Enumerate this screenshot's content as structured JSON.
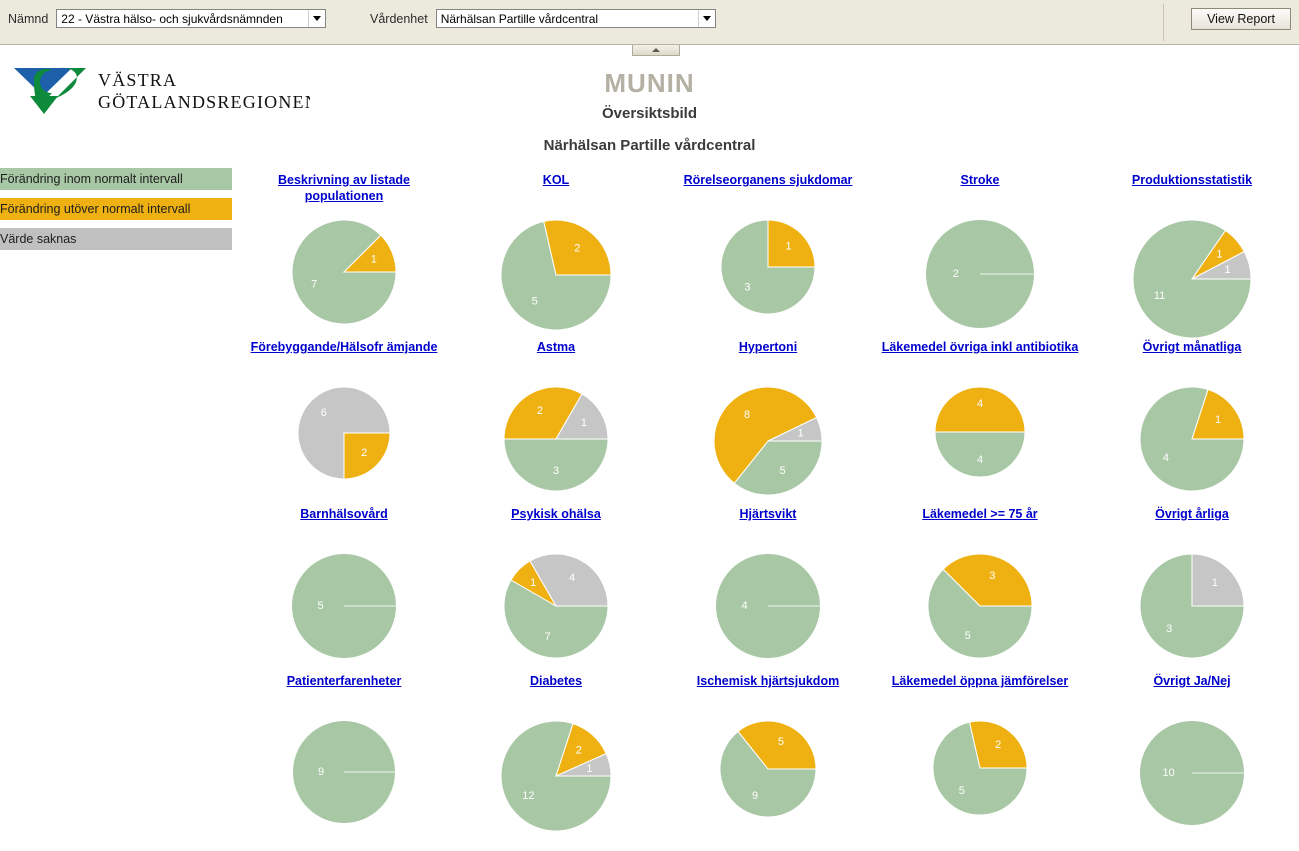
{
  "toolbar": {
    "namnd_label": "Nämnd",
    "namnd_value": "22 - Västra hälso- och sjukvårdsnämnden",
    "vardenhet_label": "Vårdenhet",
    "vardenhet_value": "Närhälsan Partille vårdcentral",
    "view_report_label": "View Report"
  },
  "logo": {
    "line1": "VÄSTRA",
    "line2": "GÖTALANDSREGIONEN",
    "blue": "#1d5fa8",
    "green": "#0e8a3c"
  },
  "header": {
    "app_title": "MUNIN",
    "subtitle": "Översiktsbild",
    "unit": "Närhälsan Partille vårdcentral"
  },
  "legend": {
    "items": [
      {
        "label": "Förändring inom normalt intervall",
        "color": "#a8c7a4"
      },
      {
        "label": "Förändring utöver normalt intervall",
        "color": "#eeb111"
      },
      {
        "label": "Värde saknas",
        "color": "#c0c0c0"
      }
    ]
  },
  "colors": {
    "green": "#a8c7a4",
    "orange": "#eeb111",
    "gray": "#c6c6c6",
    "link": "#0000cc",
    "munin": "#b4b0a4"
  },
  "chart_data": [
    {
      "type": "pie",
      "title": "Beskrivning av listade populationen",
      "categories": [
        "Förändring inom normalt intervall",
        "Förändring utöver normalt intervall",
        "Värde saknas"
      ],
      "values": [
        7,
        1,
        0
      ],
      "r": 52
    },
    {
      "type": "pie",
      "title": "KOL",
      "categories": [
        "Förändring inom normalt intervall",
        "Förändring utöver normalt intervall",
        "Värde saknas"
      ],
      "values": [
        5,
        2,
        0
      ],
      "r": 55
    },
    {
      "type": "pie",
      "title": "Rörelseorganens sjukdomar",
      "categories": [
        "Förändring inom normalt intervall",
        "Förändring utöver normalt intervall",
        "Värde saknas"
      ],
      "values": [
        3,
        1,
        0
      ],
      "r": 47
    },
    {
      "type": "pie",
      "title": "Stroke",
      "categories": [
        "Förändring inom normalt intervall",
        "Förändring utöver normalt intervall",
        "Värde saknas"
      ],
      "values": [
        2,
        0,
        0
      ],
      "r": 54
    },
    {
      "type": "pie",
      "title": "Produktionsstatistik",
      "categories": [
        "Förändring inom normalt intervall",
        "Förändring utöver normalt intervall",
        "Värde saknas"
      ],
      "values": [
        11,
        1,
        1
      ],
      "r": 59
    },
    {
      "type": "pie",
      "title": "Förebyggande/Hälsofr ämjande",
      "categories": [
        "Förändring inom normalt intervall",
        "Förändring utöver normalt intervall",
        "Värde saknas"
      ],
      "values": [
        0,
        2,
        6
      ],
      "r": 46
    },
    {
      "type": "pie",
      "title": "Astma",
      "categories": [
        "Förändring inom normalt intervall",
        "Förändring utöver normalt intervall",
        "Värde saknas"
      ],
      "values": [
        3,
        2,
        1
      ],
      "r": 52
    },
    {
      "type": "pie",
      "title": "Hypertoni",
      "categories": [
        "Förändring inom normalt intervall",
        "Förändring utöver normalt intervall",
        "Värde saknas"
      ],
      "values": [
        5,
        8,
        1
      ],
      "r": 54
    },
    {
      "type": "pie",
      "title": "Läkemedel övriga inkl antibiotika",
      "categories": [
        "Förändring inom normalt intervall",
        "Förändring utöver normalt intervall",
        "Värde saknas"
      ],
      "values": [
        4,
        4,
        0
      ],
      "r": 45
    },
    {
      "type": "pie",
      "title": "Övrigt månatliga",
      "categories": [
        "Förändring inom normalt intervall",
        "Förändring utöver normalt intervall",
        "Värde saknas"
      ],
      "values": [
        4,
        1,
        0
      ],
      "r": 52
    },
    {
      "type": "pie",
      "title": "Barnhälsovård",
      "categories": [
        "Förändring inom normalt intervall",
        "Förändring utöver normalt intervall",
        "Värde saknas"
      ],
      "values": [
        5,
        0,
        0
      ],
      "r": 52
    },
    {
      "type": "pie",
      "title": "Psykisk ohälsa",
      "categories": [
        "Förändring inom normalt intervall",
        "Förändring utöver normalt intervall",
        "Värde saknas"
      ],
      "values": [
        7,
        1,
        4
      ],
      "r": 52
    },
    {
      "type": "pie",
      "title": "Hjärtsvikt",
      "categories": [
        "Förändring inom normalt intervall",
        "Förändring utöver normalt intervall",
        "Värde saknas"
      ],
      "values": [
        4,
        0,
        0
      ],
      "r": 52
    },
    {
      "type": "pie",
      "title": "Läkemedel >= 75 år",
      "categories": [
        "Förändring inom normalt intervall",
        "Förändring utöver normalt intervall",
        "Värde saknas"
      ],
      "values": [
        5,
        3,
        0
      ],
      "r": 52
    },
    {
      "type": "pie",
      "title": "Övrigt årliga",
      "categories": [
        "Förändring inom normalt intervall",
        "Förändring utöver normalt intervall",
        "Värde saknas"
      ],
      "values": [
        3,
        0,
        1
      ],
      "r": 52
    },
    {
      "type": "pie",
      "title": "Patienterfarenheter",
      "categories": [
        "Förändring inom normalt intervall",
        "Förändring utöver normalt intervall",
        "Värde saknas"
      ],
      "values": [
        9,
        0,
        0
      ],
      "r": 51
    },
    {
      "type": "pie",
      "title": "Diabetes",
      "categories": [
        "Förändring inom normalt intervall",
        "Förändring utöver normalt intervall",
        "Värde saknas"
      ],
      "values": [
        12,
        2,
        1
      ],
      "r": 55
    },
    {
      "type": "pie",
      "title": "Ischemisk hjärtsjukdom",
      "categories": [
        "Förändring inom normalt intervall",
        "Förändring utöver normalt intervall",
        "Värde saknas"
      ],
      "values": [
        9,
        5,
        0
      ],
      "r": 48
    },
    {
      "type": "pie",
      "title": "Läkemedel öppna jämförelser",
      "categories": [
        "Förändring inom normalt intervall",
        "Förändring utöver normalt intervall",
        "Värde saknas"
      ],
      "values": [
        5,
        2,
        0
      ],
      "r": 47
    },
    {
      "type": "pie",
      "title": "Övrigt Ja/Nej",
      "categories": [
        "Förändring inom normalt intervall",
        "Förändring utöver normalt intervall",
        "Värde saknas"
      ],
      "values": [
        10,
        0,
        0
      ],
      "r": 52
    }
  ]
}
